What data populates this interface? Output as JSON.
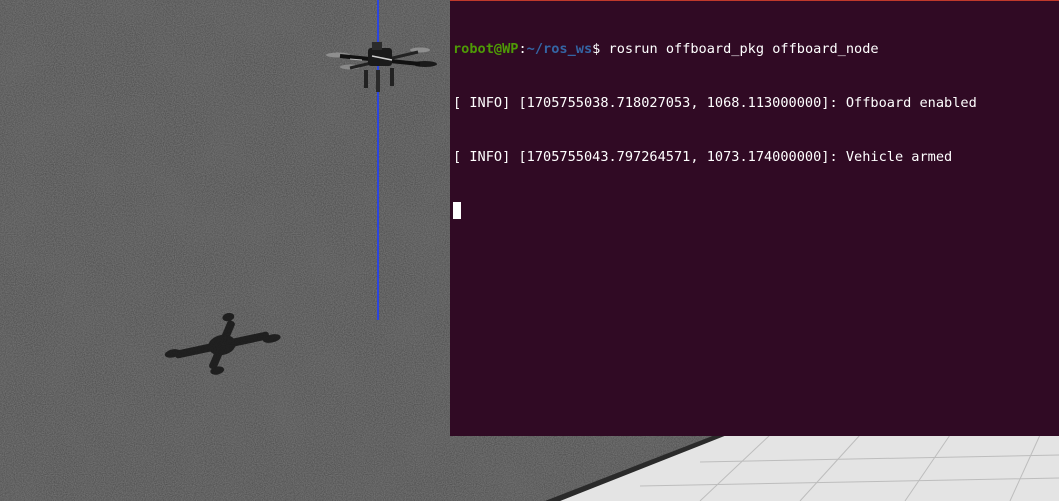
{
  "terminal": {
    "prompt_user": "robot@WP",
    "prompt_sep": ":",
    "prompt_path": "~/ros_ws",
    "prompt_symbol": "$ ",
    "command": "rosrun offboard_pkg offboard_node",
    "output": [
      "[ INFO] [1705755038.718027053, 1068.113000000]: Offboard enabled",
      "[ INFO] [1705755043.797264571, 1073.174000000]: Vehicle armed"
    ],
    "background": "#300a24",
    "user_color": "#4e9a06",
    "path_color": "#3465a4"
  },
  "scene": {
    "ground_color": "#454545",
    "tile_color": "#e6e6e6",
    "axis_line_color": "#1f3fff",
    "icons": [
      "quadcopter-drone-icon",
      "drone-shadow-icon"
    ]
  }
}
